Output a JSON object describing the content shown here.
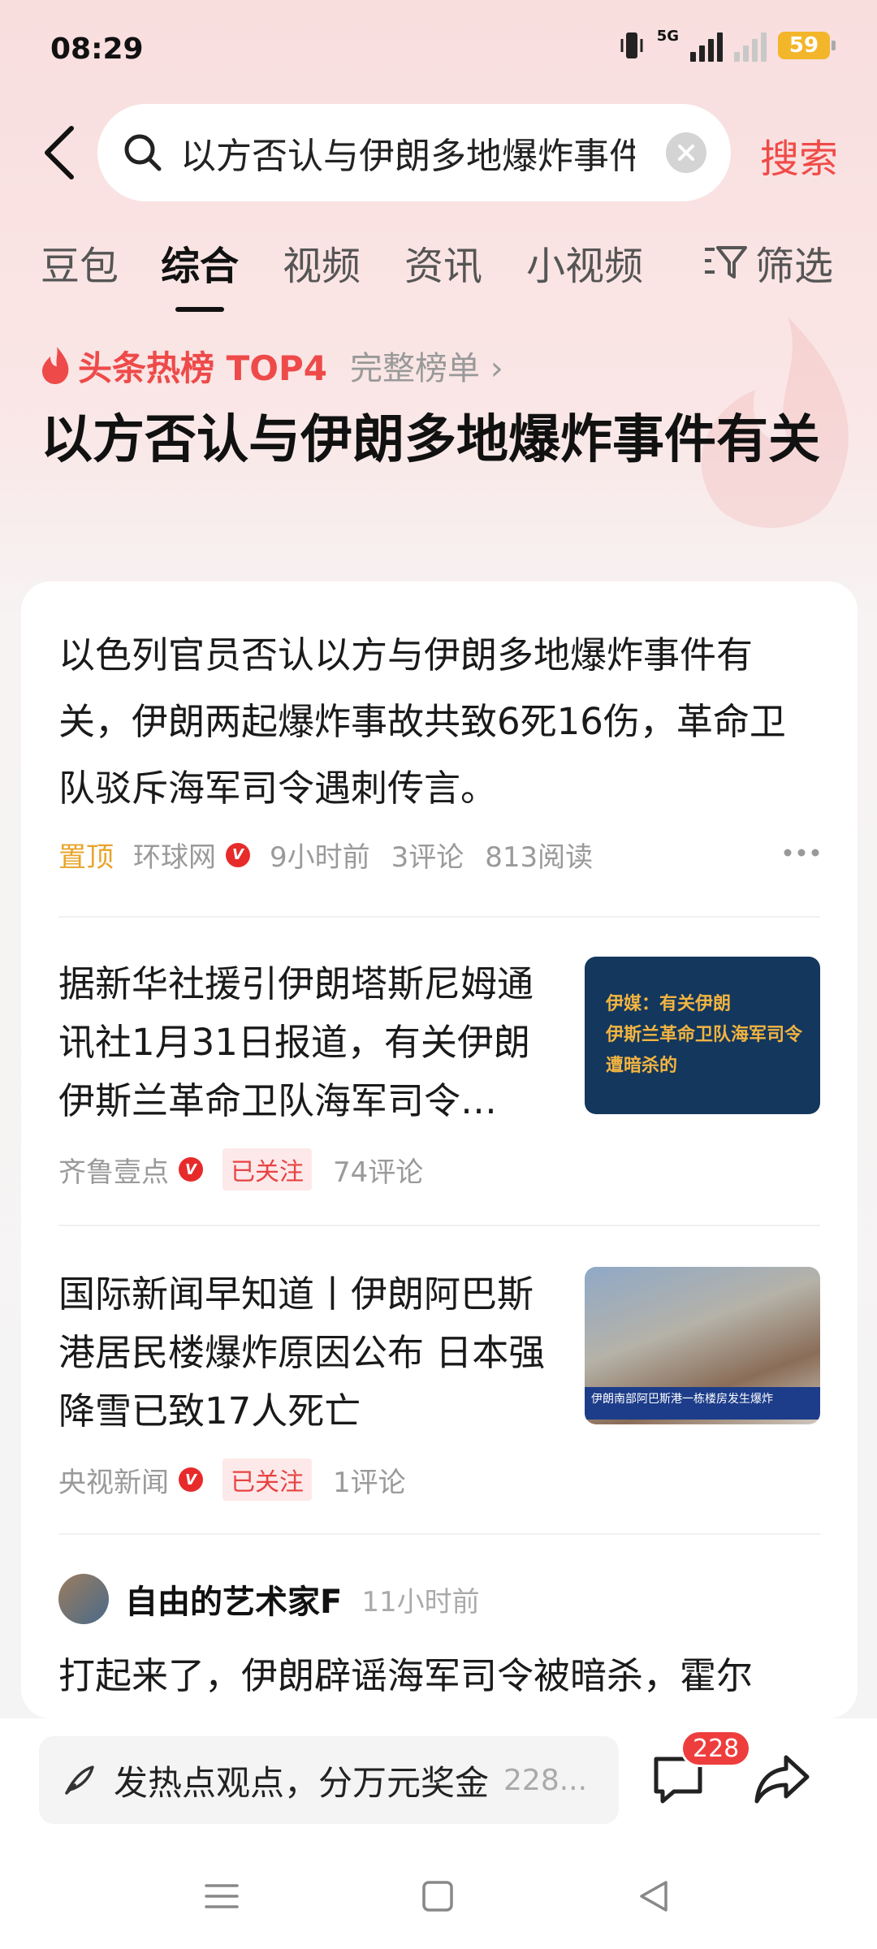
{
  "status": {
    "time": "08:29",
    "network": "5G",
    "battery": "59"
  },
  "search": {
    "query": "以方否认与伊朗多地爆炸事件有关",
    "submit_label": "搜索"
  },
  "tabs": [
    "豆包",
    "综合",
    "视频",
    "资讯",
    "小视频"
  ],
  "active_tab": "综合",
  "filter_label": "筛选",
  "hot": {
    "label": "头条热榜 TOP4",
    "more": "完整榜单 ›",
    "title": "以方否认与伊朗多地爆炸事件有关"
  },
  "lead_item": {
    "text": "以色列官员否认以方与伊朗多地爆炸事件有关，伊朗两起爆炸事故共致6死16伤，革命卫队驳斥海军司令遇刺传言。",
    "pin": "置顶",
    "source": "环球网",
    "time": "9小时前",
    "comments": "3评论",
    "reads": "813阅读"
  },
  "news": [
    {
      "title": "据新华社援引伊朗塔斯尼姆通讯社1月31日报道，有关伊朗伊斯兰革命卫队海军司令…",
      "source": "齐鲁壹点",
      "follow": "已关注",
      "comments": "74评论",
      "thumb_lines": [
        "伊媒：有关伊朗",
        "伊斯兰革命卫队海军司令",
        "遭暗杀的"
      ]
    },
    {
      "title": "国际新闻早知道丨伊朗阿巴斯港居民楼爆炸原因公布 日本强降雪已致17人死亡",
      "source": "央视新闻",
      "follow": "已关注",
      "comments": "1评论",
      "thumb_ticker": "伊朗南部阿巴斯港一栋楼房发生爆炸"
    }
  ],
  "post": {
    "user": "自由的艺术家F",
    "time": "11小时前",
    "text": "打起来了，伊朗辟谣海军司令被暗杀，霍尔"
  },
  "bottom": {
    "placeholder": "发热点观点，分万元奖金",
    "count": "228...",
    "badge": "228"
  },
  "colors": {
    "accent": "#ef4b48",
    "pin": "#e8a42a",
    "verified": "#e72b2b"
  }
}
